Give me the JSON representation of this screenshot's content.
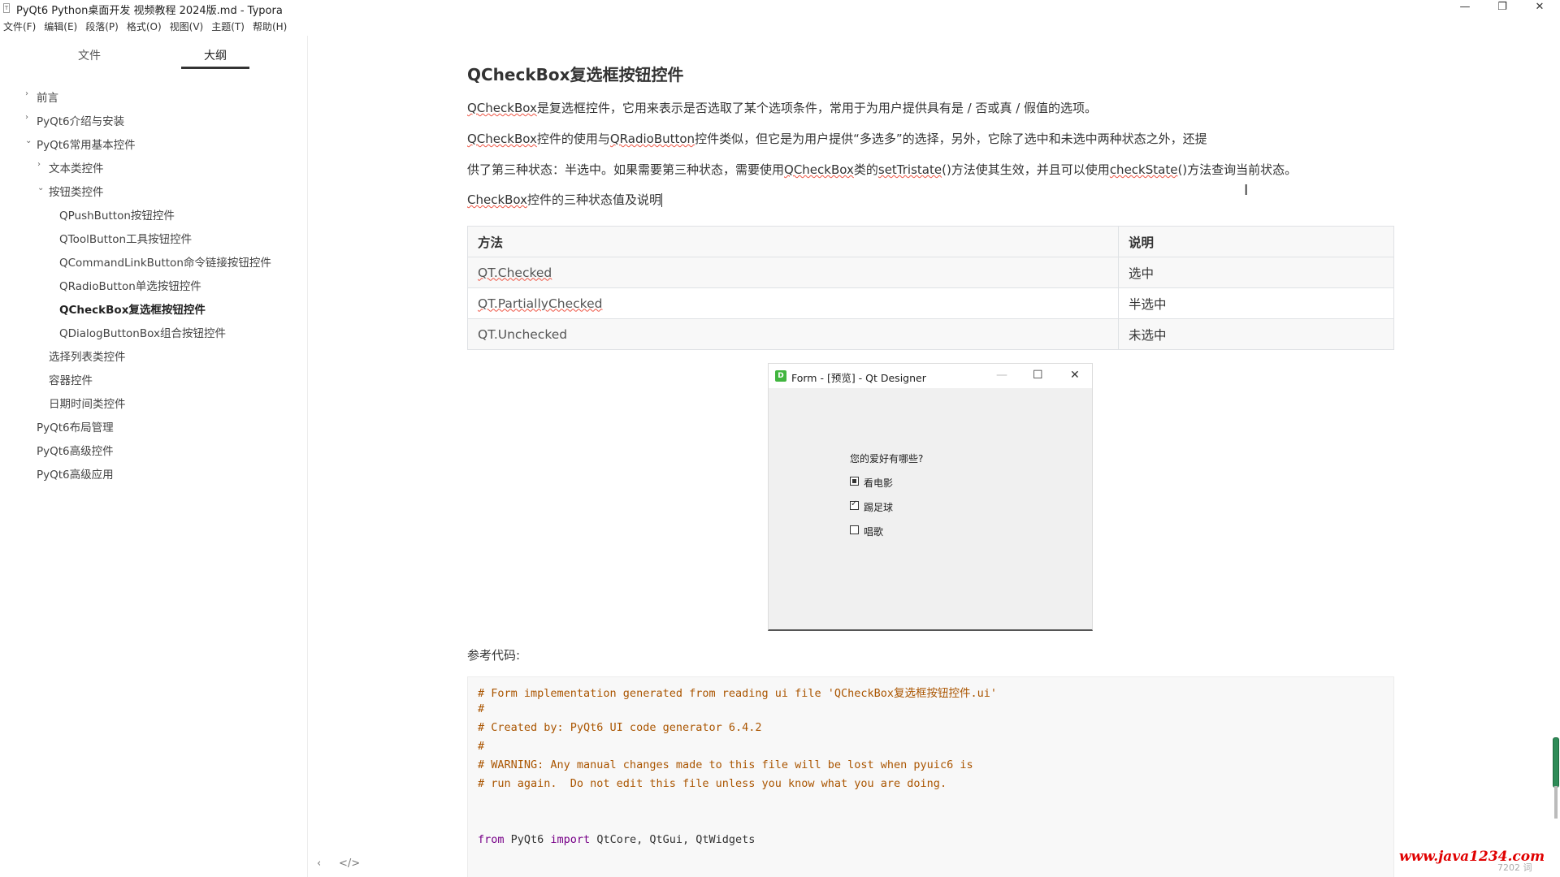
{
  "window": {
    "title": "PyQt6 Python桌面开发 视频教程 2024版.md - Typora",
    "controls": [
      "—",
      "❐",
      "✕"
    ]
  },
  "menu": [
    "文件(F)",
    "编辑(E)",
    "段落(P)",
    "格式(O)",
    "视图(V)",
    "主题(T)",
    "帮助(H)"
  ],
  "sidebar": {
    "tabs": [
      "文件",
      "大纲"
    ],
    "active_tab": "大纲",
    "outline": [
      {
        "label": "前言",
        "chev": "›"
      },
      {
        "label": "PyQt6介绍与安装",
        "chev": "›"
      },
      {
        "label": "PyQt6常用基本控件",
        "chev": "⌄"
      },
      {
        "label": "文本类控件",
        "chev": "›"
      },
      {
        "label": "按钮类控件",
        "chev": "⌄"
      },
      {
        "label": "QPushButton按钮控件",
        "chev": ""
      },
      {
        "label": "QToolButton工具按钮控件",
        "chev": ""
      },
      {
        "label": "QCommandLinkButton命令链接按钮控件",
        "chev": ""
      },
      {
        "label": "QRadioButton单选按钮控件",
        "chev": ""
      },
      {
        "label": "QCheckBox复选框按钮控件",
        "chev": ""
      },
      {
        "label": "QDialogButtonBox组合按钮控件",
        "chev": ""
      },
      {
        "label": "选择列表类控件",
        "chev": ""
      },
      {
        "label": "容器控件",
        "chev": ""
      },
      {
        "label": "日期时间类控件",
        "chev": ""
      },
      {
        "label": "PyQt6布局管理",
        "chev": ""
      },
      {
        "label": "PyQt6高级控件",
        "chev": ""
      },
      {
        "label": "PyQt6高级应用",
        "chev": ""
      }
    ],
    "footer": [
      "‹",
      "</>"
    ]
  },
  "doc": {
    "heading": "QCheckBox复选框按钮控件",
    "p1": {
      "a": "QCheckBox",
      "b": "是复选框控件，它用来表示是否选取了某个选项条件，常用于为用户提供具有是 / 否或真 / 假值的选项。"
    },
    "p2": {
      "a": "QCheckBox",
      "b": "控件的使用与",
      "c": "QRadioButton",
      "d": "控件类似，但它是为用户提供“多选多”的选择，另外，它除了选中和未选中两种状态之外，还提"
    },
    "p3": {
      "a": "供了第三种状态：半选中。如果需要第三种状态，需要使用",
      "b": "QCheckBox",
      "c": "类的",
      "d": "setTristate",
      "e": "()方法使其生效，并且可以使用",
      "f": "checkState",
      "g": "()方法查询当前状态。"
    },
    "p4": {
      "a": "CheckBox",
      "b": "控件的三种状态值及说明"
    },
    "table": {
      "headers": [
        "方法",
        "说明"
      ],
      "rows": [
        [
          "QT.Checked",
          "选中"
        ],
        [
          "QT.PartiallyChecked",
          "半选中"
        ],
        [
          "QT.Unchecked",
          "未选中"
        ]
      ]
    },
    "qt": {
      "icon": "D",
      "title": "Form - [预览] - Qt Designer",
      "controls": [
        "—",
        "☐",
        "✕"
      ],
      "label": "您的爱好有哪些?",
      "checkboxes": [
        "看电影",
        "踢足球",
        "唱歌"
      ]
    },
    "ref_label": "参考代码:",
    "code": {
      "l1": "# Form implementation generated from reading ui file 'QCheckBox复选框按钮控件.ui'",
      "l2": "#",
      "l3": "# Created by: PyQt6 UI code generator 6.4.2",
      "l4": "#",
      "l5": "# WARNING: Any manual changes made to this file will be lost when pyuic6 is",
      "l6": "# run again.  Do not edit this file unless you know what you are doing.",
      "l9_kw1": "from",
      "l9_mod": " PyQt6 ",
      "l9_kw2": "import",
      "l9_rest": " QtCore, QtGui, QtWidgets"
    }
  },
  "status": {
    "wordcount": "7202 词",
    "watermark": "www.java1234.com"
  }
}
